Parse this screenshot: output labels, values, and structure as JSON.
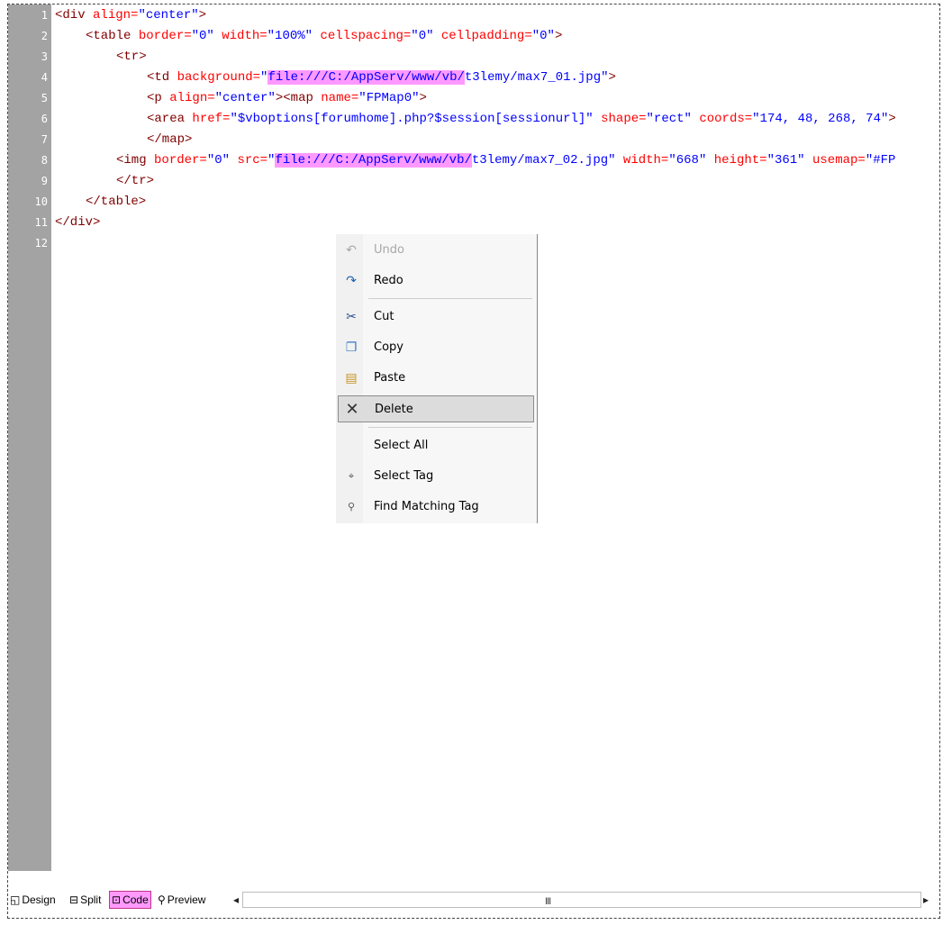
{
  "line_numbers": [
    "1",
    "2",
    "3",
    "4",
    "5",
    "6",
    "7",
    "8",
    "9",
    "10",
    "11",
    "12"
  ],
  "code": {
    "l1": {
      "t1": "<div ",
      "a1": "align=",
      "v1": "\"center\"",
      "t2": ">"
    },
    "l2": {
      "t1": "<table ",
      "a1": "border=",
      "v1": "\"0\" ",
      "a2": "width=",
      "v2": "\"100%\" ",
      "a3": "cellspacing=",
      "v3": "\"0\" ",
      "a4": "cellpadding=",
      "v4": "\"0\"",
      "t2": ">"
    },
    "l3": {
      "t1": "<tr>"
    },
    "l4": {
      "t1": "<td ",
      "a1": "background=",
      "v1": "\"",
      "hl": "file:///C:/AppServ/www/vb/",
      "v2": "t3lemy/max7_01.jpg\"",
      "t2": ">"
    },
    "l5": {
      "t1": "<p ",
      "a1": "align=",
      "v1": "\"center\"",
      "t2": "><map ",
      "a2": "name=",
      "v2": "\"FPMap0\"",
      "t3": ">"
    },
    "l6": {
      "t1": "<area ",
      "a1": "href=",
      "v1": "\"$vboptions[forumhome].php?$session[sessionurl]\" ",
      "a2": "shape=",
      "v2": "\"rect\" ",
      "a3": "coords=",
      "v3": "\"174, 48, 268, 74\"",
      "t2": ">"
    },
    "l7": {
      "t1": "</map>"
    },
    "l8": {
      "t1": "<img ",
      "a1": "border=",
      "v1": "\"0\" ",
      "a2": "src=",
      "v2": "\"",
      "hl": "file:///C:/AppServ/www/vb/",
      "v3": "t3lemy/max7_02.jpg\" ",
      "a3": "width=",
      "v4": "\"668\" ",
      "a4": "height=",
      "v5": "\"361\" ",
      "a5": "usemap=",
      "v6": "\"#FP"
    },
    "l9": {
      "t1": "</tr>"
    },
    "l10": {
      "t1": "</table>"
    },
    "l11": {
      "t1": "</div>"
    }
  },
  "context_menu": {
    "undo": {
      "label": "Undo",
      "icon": "undo-icon",
      "enabled": false
    },
    "redo": {
      "label": "Redo",
      "icon": "redo-icon"
    },
    "cut": {
      "label": "Cut",
      "icon": "scissors-icon"
    },
    "copy": {
      "label": "Copy",
      "icon": "copy-icon"
    },
    "paste": {
      "label": "Paste",
      "icon": "paste-icon"
    },
    "delete": {
      "label": "Delete",
      "icon": "delete-x-icon",
      "selected": true
    },
    "select_all": {
      "label": "Select All"
    },
    "select_tag": {
      "label": "Select Tag",
      "icon": "select-tag-icon"
    },
    "find_matching_tag": {
      "label": "Find Matching Tag",
      "icon": "matching-tag-icon"
    }
  },
  "view_tabs": {
    "design": "Design",
    "split": "Split",
    "code": "Code",
    "preview": "Preview",
    "active": "Code"
  },
  "scrollbar": {
    "grip": "III"
  },
  "colors": {
    "highlight": "#ff99ff",
    "gutter": "#a3a3a3",
    "tag": "#800000",
    "attr": "#ff0000",
    "value": "#0000ff"
  }
}
